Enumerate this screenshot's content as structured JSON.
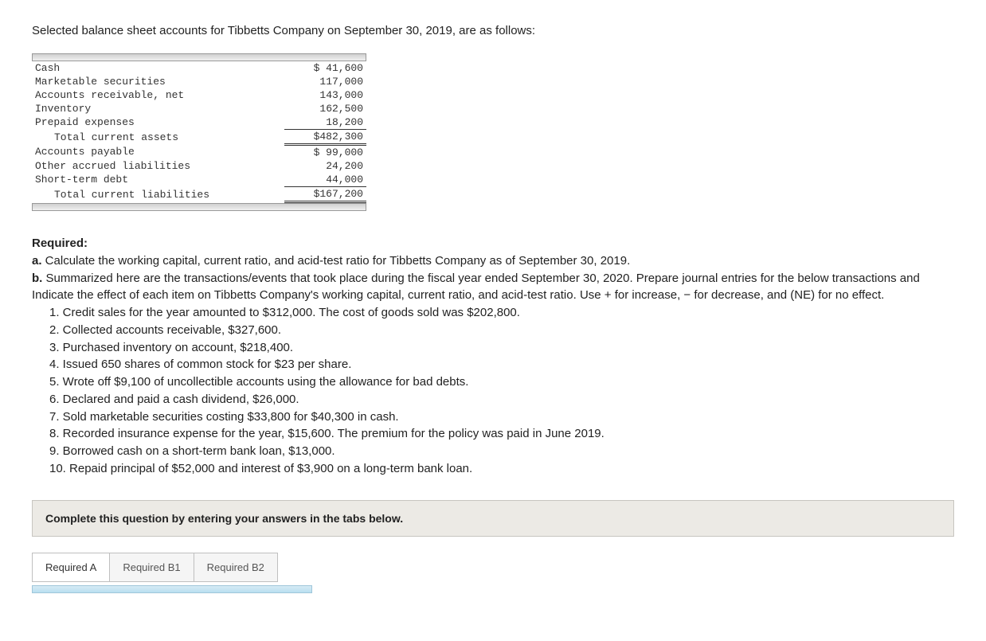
{
  "intro": "Selected balance sheet accounts for Tibbetts Company on September 30, 2019, are as follows:",
  "bs": {
    "rows": [
      {
        "label": "Cash",
        "val": "$ 41,600",
        "indent": false,
        "cls": ""
      },
      {
        "label": "Marketable securities",
        "val": "117,000",
        "indent": false,
        "cls": ""
      },
      {
        "label": "Accounts receivable, net",
        "val": "143,000",
        "indent": false,
        "cls": ""
      },
      {
        "label": "Inventory",
        "val": "162,500",
        "indent": false,
        "cls": ""
      },
      {
        "label": "Prepaid expenses",
        "val": "18,200",
        "indent": false,
        "cls": "underline"
      },
      {
        "label": "Total current assets",
        "val": "$482,300",
        "indent": true,
        "cls": "dbl-under"
      },
      {
        "label": "Accounts payable",
        "val": "$ 99,000",
        "indent": false,
        "cls": ""
      },
      {
        "label": "Other accrued liabilities",
        "val": "24,200",
        "indent": false,
        "cls": ""
      },
      {
        "label": "Short-term debt",
        "val": "44,000",
        "indent": false,
        "cls": "underline"
      },
      {
        "label": "Total current liabilities",
        "val": "$167,200",
        "indent": true,
        "cls": "dbl-under"
      }
    ]
  },
  "req": {
    "hdr": "Required:",
    "a_prefix": "a.",
    "a_text": " Calculate the working capital, current ratio, and acid-test ratio for Tibbetts Company as of September 30, 2019.",
    "b_prefix": "b.",
    "b_text": " Summarized here are the transactions/events that took place during the fiscal year ended September 30, 2020. Prepare journal entries for the below transactions and Indicate the effect of each item on Tibbetts Company's working capital, current ratio, and acid-test ratio. Use + for increase, − for decrease, and (NE) for no effect.",
    "items": [
      "1. Credit sales for the year amounted to $312,000. The cost of goods sold was $202,800.",
      "2. Collected accounts receivable, $327,600.",
      "3. Purchased inventory on account, $218,400.",
      "4. Issued 650 shares of common stock for $23 per share.",
      "5. Wrote off $9,100 of uncollectible accounts using the allowance for bad debts.",
      "6. Declared and paid a cash dividend, $26,000.",
      "7. Sold marketable securities costing $33,800 for $40,300 in cash.",
      "8. Recorded insurance expense for the year, $15,600. The premium for the policy was paid in June 2019.",
      "9. Borrowed cash on a short-term bank loan, $13,000.",
      "10. Repaid principal of $52,000 and interest of $3,900 on a long-term bank loan."
    ]
  },
  "instr": "Complete this question by entering your answers in the tabs below.",
  "tabs": {
    "a": "Required A",
    "b1": "Required B1",
    "b2": "Required B2"
  }
}
